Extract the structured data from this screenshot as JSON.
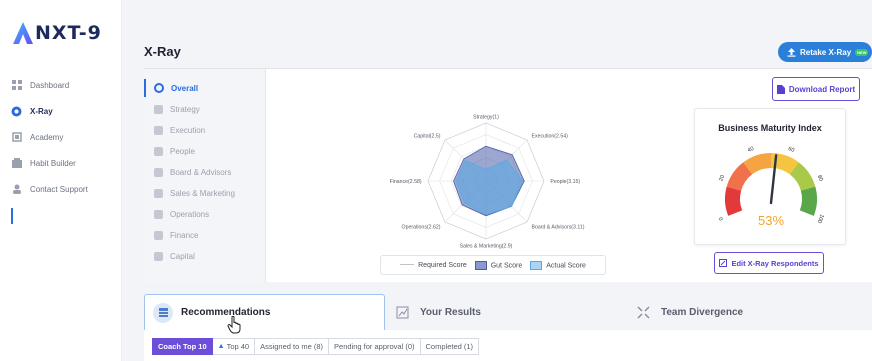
{
  "app": {
    "logo_text": "NXT-9"
  },
  "sidebar": {
    "items": [
      {
        "label": "Dashboard",
        "icon": "grid-icon"
      },
      {
        "label": "X-Ray",
        "icon": "xray-icon",
        "active": true
      },
      {
        "label": "Academy",
        "icon": "academy-icon"
      },
      {
        "label": "Habit Builder",
        "icon": "habit-icon"
      },
      {
        "label": "Contact Support",
        "icon": "support-icon"
      }
    ]
  },
  "header": {
    "title": "X-Ray",
    "retake_label": "Retake X-Ray",
    "retake_badge": "NEW"
  },
  "categories": [
    {
      "label": "Overall",
      "active": true
    },
    {
      "label": "Strategy"
    },
    {
      "label": "Execution"
    },
    {
      "label": "People"
    },
    {
      "label": "Board & Advisors"
    },
    {
      "label": "Sales & Marketing"
    },
    {
      "label": "Operations"
    },
    {
      "label": "Finance"
    },
    {
      "label": "Capital"
    }
  ],
  "chart_data": {
    "type": "radar",
    "axes": [
      "Strategy(1)",
      "Execution(2.54)",
      "People(3.15)",
      "Board & Advisors(3.11)",
      "Sales & Marketing(2.9)",
      "Operations(2.62)",
      "Finance(2.58)",
      "Capital(2.5)"
    ],
    "series": [
      {
        "name": "Required Score",
        "values": [
          5,
          5,
          5,
          5,
          5,
          5,
          5,
          5
        ]
      },
      {
        "name": "Gut Score",
        "values": [
          3.0,
          3.2,
          3.3,
          3.1,
          3.0,
          2.9,
          2.8,
          2.7
        ]
      },
      {
        "name": "Actual Score",
        "values": [
          1,
          2.54,
          3.15,
          3.11,
          2.9,
          2.62,
          2.58,
          2.5
        ]
      }
    ],
    "max": 5
  },
  "legend": {
    "required": "Required Score",
    "gut": "Gut Score",
    "actual": "Actual Score"
  },
  "download_label": "Download Report",
  "bmi": {
    "title": "Business Maturity Index",
    "value": 53,
    "value_label": "53%",
    "ticks": [
      "0",
      "20",
      "40",
      "60",
      "80",
      "100"
    ]
  },
  "edit_label": "Edit X-Ray Respondents",
  "tabs": [
    {
      "label": "Recommendations",
      "active": true
    },
    {
      "label": "Your Results"
    },
    {
      "label": "Team Divergence"
    }
  ],
  "filters": [
    {
      "label": "Coach Top 10",
      "active": true
    },
    {
      "label": "Top 40"
    },
    {
      "label": "Assigned to me (8)"
    },
    {
      "label": "Pending for approval (0)"
    },
    {
      "label": "Completed (1)"
    }
  ],
  "colors": {
    "accent": "#6c4ed8",
    "primary_blue": "#2b7fd9",
    "actual_fill": "#5aa9e6",
    "gut_fill": "#4a5ea8"
  }
}
